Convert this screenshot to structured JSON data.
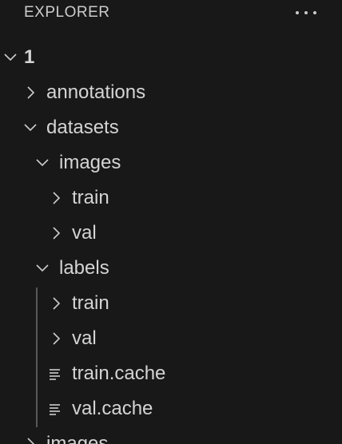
{
  "header": {
    "title": "EXPLORER",
    "more_icon": "ellipsis-icon"
  },
  "tree": [
    {
      "label": "1",
      "type": "folder",
      "expanded": true,
      "depth": 0,
      "bold": true
    },
    {
      "label": "annotations",
      "type": "folder",
      "expanded": false,
      "depth": 1
    },
    {
      "label": "datasets",
      "type": "folder",
      "expanded": true,
      "depth": 1
    },
    {
      "label": "images",
      "type": "folder",
      "expanded": true,
      "depth": 2
    },
    {
      "label": "train",
      "type": "folder",
      "expanded": false,
      "depth": 3
    },
    {
      "label": "val",
      "type": "folder",
      "expanded": false,
      "depth": 3
    },
    {
      "label": "labels",
      "type": "folder",
      "expanded": true,
      "depth": 2
    },
    {
      "label": "train",
      "type": "folder",
      "expanded": false,
      "depth": 3
    },
    {
      "label": "val",
      "type": "folder",
      "expanded": false,
      "depth": 3
    },
    {
      "label": "train.cache",
      "type": "file",
      "depth": 3
    },
    {
      "label": "val.cache",
      "type": "file",
      "depth": 3
    },
    {
      "label": "images",
      "type": "folder",
      "expanded": false,
      "depth": 1
    }
  ],
  "colors": {
    "background": "#181818",
    "text": "#cccccc",
    "indent_guide": "#585858"
  }
}
